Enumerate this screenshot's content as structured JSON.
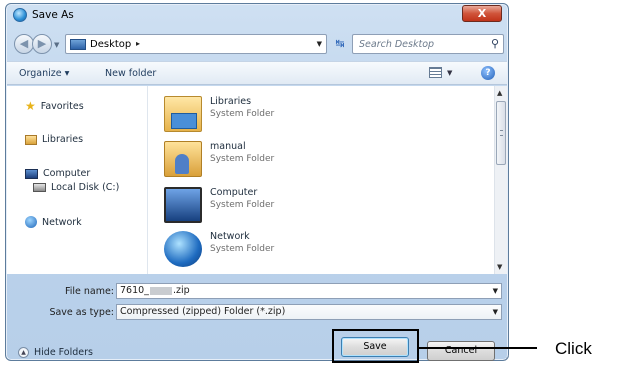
{
  "window": {
    "title": "Save As",
    "close_label": "X"
  },
  "nav": {
    "address": "Desktop",
    "address_sep": "▸",
    "search_placeholder": "Search Desktop"
  },
  "toolbar": {
    "organize": "Organize ▾",
    "new_folder": "New folder"
  },
  "sidebar": {
    "items": [
      {
        "label": "Favorites"
      },
      {
        "label": "Libraries"
      },
      {
        "label": "Computer"
      },
      {
        "label": "Local Disk (C:)"
      },
      {
        "label": "Network"
      }
    ]
  },
  "files": [
    {
      "name": "Libraries",
      "type": "System Folder"
    },
    {
      "name": "manual",
      "type": "System Folder"
    },
    {
      "name": "Computer",
      "type": "System Folder"
    },
    {
      "name": "Network",
      "type": "System Folder"
    }
  ],
  "form": {
    "file_name_label": "File name:",
    "file_name_prefix": "7610_",
    "file_name_suffix": ".zip",
    "save_type_label": "Save as type:",
    "save_type_value": "Compressed (zipped) Folder (*.zip)"
  },
  "footer": {
    "hide_folders": "Hide Folders",
    "save": "Save",
    "cancel": "Cancel"
  },
  "annotation": {
    "callout": "Click"
  }
}
